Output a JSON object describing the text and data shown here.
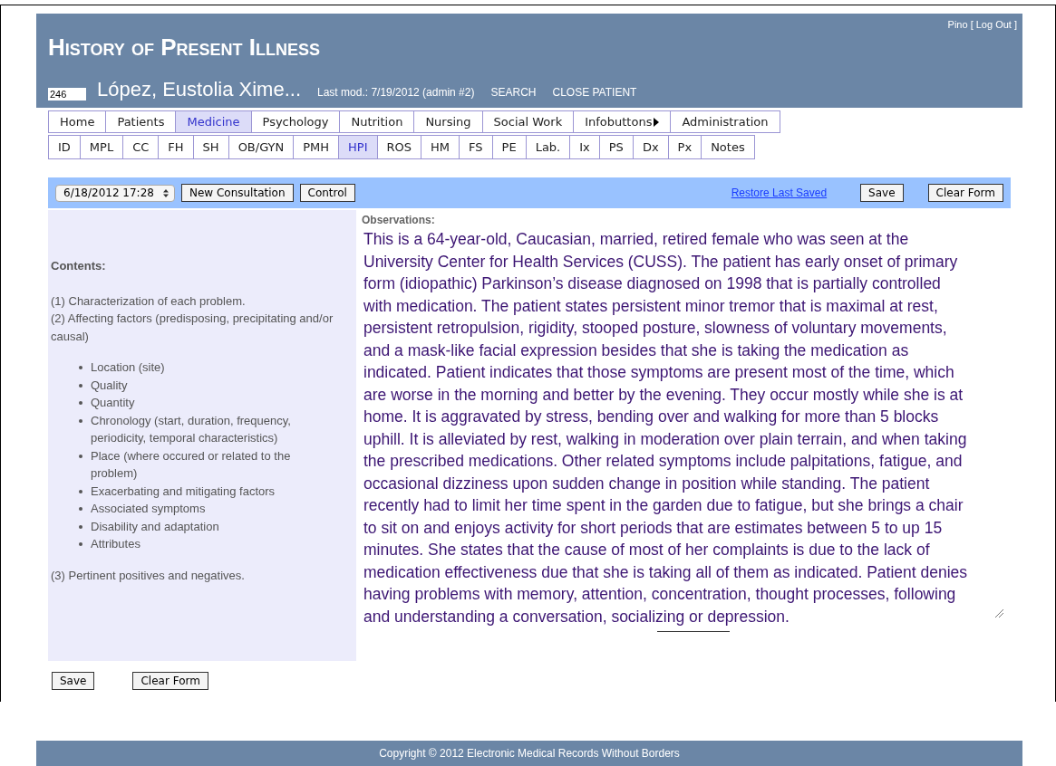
{
  "header": {
    "title": "History of Present Illness",
    "user": "Pino",
    "logout": "[ Log Out ]",
    "patient_id": "246",
    "patient_name": "López, Eustolia Xime...",
    "last_mod": "Last mod.: 7/19/2012 (admin #2)",
    "links": [
      "SEARCH",
      "CLOSE PATIENT"
    ]
  },
  "main_tabs": [
    {
      "label": "Home",
      "selected": false,
      "has_submenu": false
    },
    {
      "label": "Patients",
      "selected": false,
      "has_submenu": false
    },
    {
      "label": "Medicine",
      "selected": true,
      "has_submenu": false
    },
    {
      "label": "Psychology",
      "selected": false,
      "has_submenu": false
    },
    {
      "label": "Nutrition",
      "selected": false,
      "has_submenu": false
    },
    {
      "label": "Nursing",
      "selected": false,
      "has_submenu": false
    },
    {
      "label": "Social Work",
      "selected": false,
      "has_submenu": false
    },
    {
      "label": "Infobuttons",
      "selected": false,
      "has_submenu": true
    },
    {
      "label": "Administration",
      "selected": false,
      "has_submenu": false
    }
  ],
  "sub_tabs": [
    {
      "label": "ID",
      "selected": false
    },
    {
      "label": "MPL",
      "selected": false
    },
    {
      "label": "CC",
      "selected": false
    },
    {
      "label": "FH",
      "selected": false
    },
    {
      "label": "SH",
      "selected": false
    },
    {
      "label": "OB/GYN",
      "selected": false
    },
    {
      "label": "PMH",
      "selected": false
    },
    {
      "label": "HPI",
      "selected": true
    },
    {
      "label": "ROS",
      "selected": false
    },
    {
      "label": "HM",
      "selected": false
    },
    {
      "label": "FS",
      "selected": false
    },
    {
      "label": "PE",
      "selected": false
    },
    {
      "label": "Lab.",
      "selected": false
    },
    {
      "label": "Ix",
      "selected": false
    },
    {
      "label": "PS",
      "selected": false
    },
    {
      "label": "Dx",
      "selected": false
    },
    {
      "label": "Px",
      "selected": false
    },
    {
      "label": "Notes",
      "selected": false
    }
  ],
  "toolbar": {
    "consultation_select": "6/18/2012 17:28",
    "buttons": [
      "New Consultation",
      "Control"
    ],
    "restore_link": "Restore Last Saved",
    "right_buttons": [
      "Save",
      "Clear Form"
    ]
  },
  "contents": {
    "heading": "Contents:",
    "intro": [
      "(1) Characterization of each problem.",
      "(2) Affecting factors (predisposing, precipitating and/or causal)"
    ],
    "bullets": [
      "Location (site)",
      "Quality",
      "Quantity",
      "Chronology (start, duration, frequency, periodicity, temporal characteristics)",
      "Place (where occured or related to the problem)",
      "Exacerbating and mitigating factors",
      "Associated symptoms",
      "Disability and adaptation",
      "Attributes"
    ],
    "closing": "(3) Pertinent positives and negatives."
  },
  "observations": {
    "label": "Observations:",
    "value": "This is a 64-year-old, Caucasian, married, retired female who was seen at the University Center for Health Services (CUSS). The patient has early onset of primary form (idiopathic) Parkinson’s disease diagnosed on 1998 that is partially controlled  with medication. The patient states persistent minor tremor that is maximal at rest, persistent retropulsion, rigidity, stooped posture, slowness of voluntary movements, and a mask-like facial expression besides that she is taking the medication as indicated. Patient indicates that those symptoms are present most of the time, which are worse in the morning and better by the evening. They occur mostly while she is at home. It is aggravated by stress, bending over and walking for more than 5 blocks uphill. It is alleviated by rest, walking in moderation over plain terrain, and when taking the prescribed medications. Other related symptoms include palpitations, fatigue, and occasional dizziness upon sudden change in position while standing. The patient recently had to limit her time spent in the garden due to fatigue, but she brings a chair to sit on and enjoys activity for short periods that are estimates between 5 to up 15 minutes. She states that the cause of most of her complaints is due to the lack of medication effectiveness due that she is taking all of them as indicated. Patient denies having problems with memory, attention, concentration, thought processes, following and understanding a conversation, socializing or depression."
  },
  "bottom_buttons": [
    "Save",
    "Clear Form"
  ],
  "footer": "Copyright © 2012  Electronic Medical Records Without Borders"
}
